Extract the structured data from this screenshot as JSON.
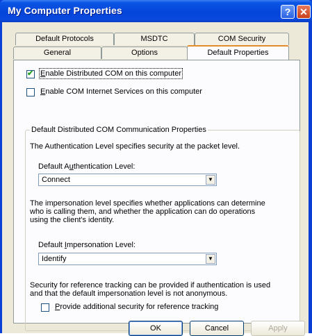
{
  "window": {
    "title": "My Computer Properties"
  },
  "titlebar_buttons": {
    "help": "?",
    "close": "✕"
  },
  "tabs": {
    "row1": [
      "Default Protocols",
      "MSDTC",
      "COM Security"
    ],
    "row2": [
      "General",
      "Options",
      "Default Properties"
    ],
    "active": "Default Properties"
  },
  "options": {
    "enable_dcom": {
      "pre": "",
      "ul": "E",
      "post": "nable Distributed COM on this computer",
      "checked": true
    },
    "enable_cis": {
      "pre": "",
      "ul": "E",
      "post": "nable COM Internet Services on this computer",
      "checked": false
    }
  },
  "group": {
    "legend": "Default Distributed COM Communication Properties",
    "auth_desc": "The Authentication Level specifies security at the packet level.",
    "auth_label": {
      "pre": "Default A",
      "ul": "u",
      "post": "thentication Level:"
    },
    "auth_value": "Connect",
    "imp_desc_lines": [
      "The impersonation level specifies whether applications can determine",
      "who is calling them, and whether the application can do operations",
      "using the client's identity."
    ],
    "imp_label": {
      "pre": "Default ",
      "ul": "I",
      "post": "mpersonation Level:"
    },
    "imp_value": "Identify",
    "sec_desc_lines": [
      "Security for reference tracking can be provided if authentication is used",
      "and that the default impersonation level is not anonymous."
    ],
    "ref_tracking": {
      "pre": "",
      "ul": "P",
      "post": "rovide additional security for reference tracking",
      "checked": false
    }
  },
  "buttons": {
    "ok": "OK",
    "cancel": "Cancel",
    "apply": "Apply"
  }
}
